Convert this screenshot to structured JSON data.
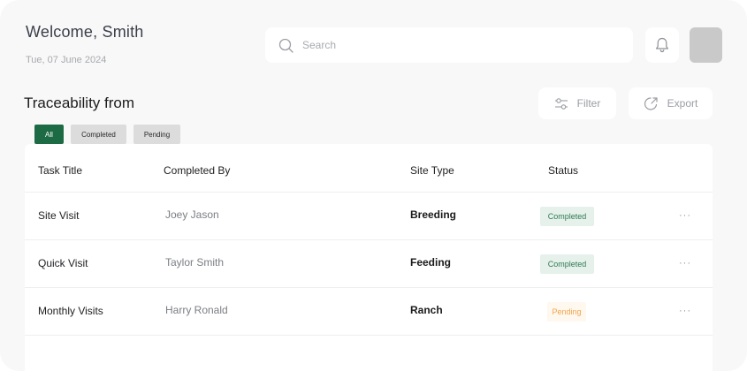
{
  "header": {
    "welcome": "Welcome, Smith",
    "date": "Tue, 07 June 2024"
  },
  "search": {
    "placeholder": "Search",
    "icon": "search-icon"
  },
  "notifications": {
    "icon": "bell-icon"
  },
  "section": {
    "title": "Traceability from"
  },
  "toolbar": {
    "filter_label": "Filter",
    "export_label": "Export",
    "filter_icon": "sliders-icon",
    "export_icon": "export-icon"
  },
  "tabs": [
    {
      "label": "All",
      "active": true
    },
    {
      "label": "Completed",
      "active": false
    },
    {
      "label": "Pending",
      "active": false
    }
  ],
  "table": {
    "columns": [
      "Task Title",
      "Completed By",
      "Site Type",
      "Status"
    ],
    "rows": [
      {
        "title": "Site Visit",
        "by": "Joey Jason",
        "site": "Breeding",
        "status": "Completed",
        "more": "···"
      },
      {
        "title": "Quick Visit",
        "by": "Taylor Smith",
        "site": "Feeding",
        "status": "Completed",
        "more": "···"
      },
      {
        "title": "Monthly Visits",
        "by": "Harry Ronald",
        "site": "Ranch",
        "status": "Pending",
        "more": "···"
      }
    ]
  },
  "colors": {
    "accent": "#1d6b45",
    "completed_text": "#2f7a52",
    "completed_bg": "#e6f1eb",
    "pending_text": "#f2a54b",
    "pending_bg": "#fff8ef"
  }
}
